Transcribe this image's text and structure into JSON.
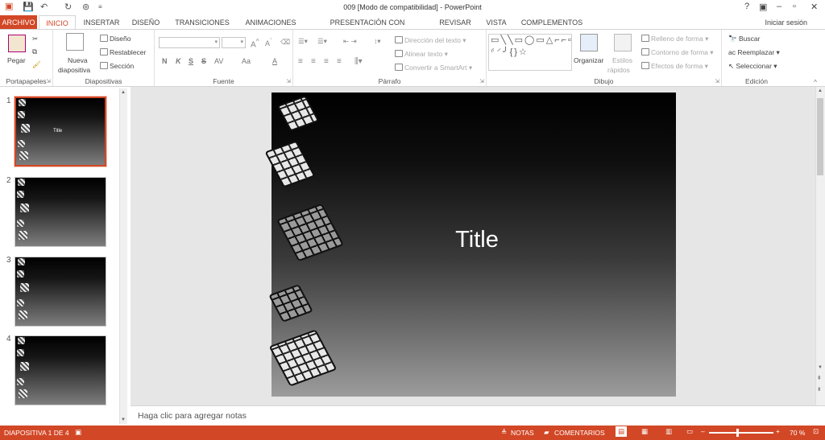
{
  "window": {
    "title": "009 [Modo de compatibilidad] - PowerPoint",
    "signin": "Iniciar sesión"
  },
  "tabs": [
    "ARCHIVO",
    "INICIO",
    "INSERTAR",
    "DISEÑO",
    "TRANSICIONES",
    "ANIMACIONES",
    "PRESENTACIÓN CON DIAPOSITIVAS",
    "REVISAR",
    "VISTA",
    "COMPLEMENTOS"
  ],
  "ribbon": {
    "clipboard": {
      "paste": "Pegar",
      "label": "Portapapeles"
    },
    "slides": {
      "new_slide_1": "Nueva",
      "new_slide_2": "diapositiva",
      "layout": "Diseño",
      "reset": "Restablecer",
      "section": "Sección",
      "label": "Diapositivas"
    },
    "font": {
      "label": "Fuente",
      "bold": "N",
      "italic": "K",
      "underline": "S",
      "strike": "S",
      "clear": "Aa",
      "color": "A"
    },
    "paragraph": {
      "text_direction": "Dirección del texto",
      "align_text": "Alinear texto",
      "smartart": "Convertir a SmartArt",
      "label": "Párrafo"
    },
    "drawing": {
      "arrange": "Organizar",
      "quick_styles_1": "Estilos",
      "quick_styles_2": "rápidos",
      "fill": "Relleno de forma",
      "outline": "Contorno de forma",
      "effects": "Efectos de forma",
      "label": "Dibujo"
    },
    "editing": {
      "find": "Buscar",
      "replace": "Reemplazar",
      "select": "Seleccionar",
      "label": "Edición"
    }
  },
  "thumbnails": [
    {
      "num": "1",
      "title": "Title"
    },
    {
      "num": "2"
    },
    {
      "num": "3"
    },
    {
      "num": "4"
    }
  ],
  "slide": {
    "title": "Title"
  },
  "notes": {
    "placeholder": "Haga clic para agregar notas"
  },
  "status": {
    "slide_counter": "DIAPOSITIVA 1 DE 4",
    "notes": "NOTAS",
    "comments": "COMENTARIOS",
    "zoom": "70 %"
  },
  "colors": {
    "accent": "#d24726"
  }
}
